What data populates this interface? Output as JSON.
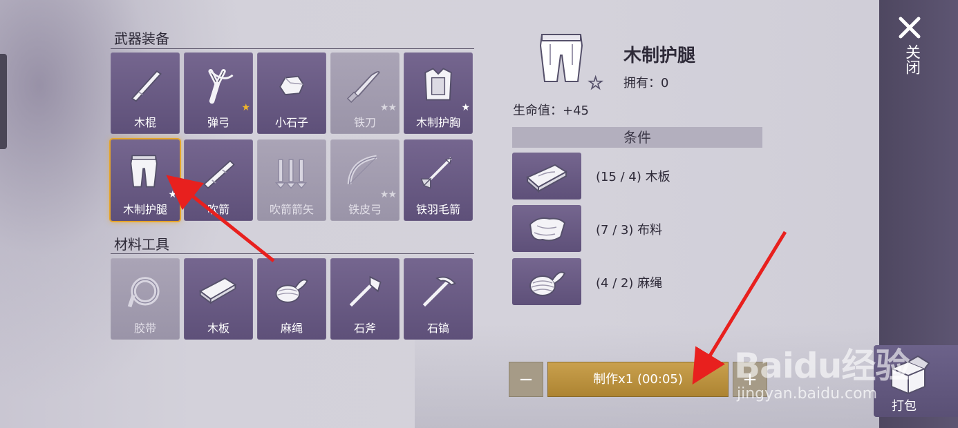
{
  "sections": {
    "weapons_title": "武器装备",
    "materials_title": "材料工具"
  },
  "weapon_items": [
    {
      "label": "木棍",
      "icon": "wooden-stick-icon",
      "stars": ""
    },
    {
      "label": "弹弓",
      "icon": "slingshot-icon",
      "stars": "★",
      "star_color": "#f0b52a"
    },
    {
      "label": "小石子",
      "icon": "pebble-icon",
      "stars": ""
    },
    {
      "label": "铁刀",
      "icon": "iron-knife-icon",
      "stars": "★★",
      "dim": true
    },
    {
      "label": "木制护胸",
      "icon": "wooden-chestplate-icon",
      "stars": "★"
    },
    {
      "label": "木制护腿",
      "icon": "wooden-leggings-icon",
      "stars": "★",
      "selected": true
    },
    {
      "label": "吹箭",
      "icon": "blowgun-icon",
      "stars": ""
    },
    {
      "label": "吹箭箭矢",
      "icon": "blowgun-darts-icon",
      "stars": "",
      "dim": true
    },
    {
      "label": "铁皮弓",
      "icon": "iron-bow-icon",
      "stars": "★★",
      "dim": true
    },
    {
      "label": "铁羽毛箭",
      "icon": "iron-feather-arrow-icon",
      "stars": ""
    }
  ],
  "material_items": [
    {
      "label": "胶带",
      "icon": "tape-icon",
      "dim": true
    },
    {
      "label": "木板",
      "icon": "plank-icon"
    },
    {
      "label": "麻绳",
      "icon": "rope-icon"
    },
    {
      "label": "石斧",
      "icon": "stone-axe-icon"
    },
    {
      "label": "石镐",
      "icon": "stone-pickaxe-icon"
    }
  ],
  "detail": {
    "name": "木制护腿",
    "owned": "拥有：0",
    "stat": "生命值：+45",
    "conditions_title": "条件",
    "materials": [
      {
        "text": "(15 / 4) 木板",
        "icon": "plank-icon"
      },
      {
        "text": "(7 / 3) 布料",
        "icon": "cloth-icon"
      },
      {
        "text": "(4 / 2) 麻绳",
        "icon": "rope-icon"
      }
    ]
  },
  "craft": {
    "minus": "−",
    "make_label": "制作x1 (00:05)",
    "plus": "+"
  },
  "side": {
    "close_label": "关闭",
    "pack_label": "打包"
  },
  "watermark": {
    "brand": "Baidu经验",
    "url": "jingyan.baidu.com"
  },
  "colors": {
    "cell_bg": "#6a5c86",
    "selected_border": "#e6a52a",
    "craft_button": "#bd9440",
    "arrow": "#e8201e"
  }
}
